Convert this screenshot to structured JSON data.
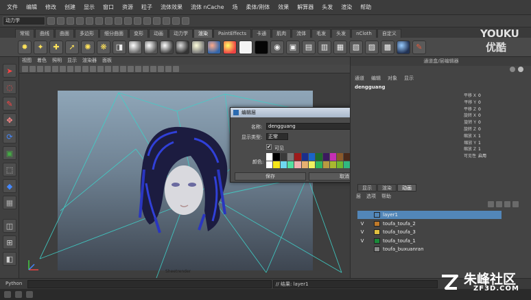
{
  "menubar": {
    "items": [
      "文件",
      "编辑",
      "修改",
      "创建",
      "显示",
      "窗口",
      "资源",
      "粒子",
      "流体效果",
      "流体 nCache",
      "场",
      "柔体/刚体",
      "效果",
      "解算器",
      "头发",
      "渲染",
      "帮助"
    ]
  },
  "statusline": {
    "mode": "动力学"
  },
  "shelf": {
    "tabs": [
      "常规",
      "曲线",
      "曲面",
      "多边形",
      "细分曲面",
      "变形",
      "动画",
      "动力学",
      "渲染",
      "PaintEffects",
      "卡通",
      "肌肉",
      "流体",
      "毛发",
      "头发",
      "nCloth",
      "自定义"
    ],
    "active_tab": "渲染"
  },
  "viewport": {
    "menu": [
      "视图",
      "着色",
      "照明",
      "显示",
      "渲染器",
      "面板"
    ],
    "camera_label": "Sheetrender"
  },
  "dialog": {
    "title": "编辑层",
    "name_label": "名称:",
    "name_value": "dengguang",
    "display_type_label": "显示类型:",
    "display_type_value": "正常",
    "visible_label": "可见",
    "visible_checked": "✔",
    "color_label": "颜色:",
    "save_label": "保存",
    "cancel_label": "取消",
    "minimize": "_",
    "maximize": "□",
    "close": "x",
    "colors_row1": [
      "#ffffff",
      "#000000",
      "#3a3a3a",
      "#7a7a7a",
      "#9e1b1b",
      "#1b2f8c",
      "#1a64c8",
      "#1f6b2b",
      "#3b1a5e",
      "#c62fb5",
      "#8b5a2b",
      "#4a2a1a",
      "#b83a1a",
      "#d41a1a",
      "#1fb81f",
      "#1a4ea8"
    ],
    "colors_row2": [
      "#ffffff",
      "#f5e61a",
      "#6fd8f0",
      "#53e0a0",
      "#f0b0b0",
      "#e8b070",
      "#f0f060",
      "#30b860",
      "#b89a40",
      "#a8b830",
      "#70b830",
      "#30b880",
      "#30b8b8",
      "#3070b8",
      "#8040b8",
      "#b83080"
    ]
  },
  "channel_box": {
    "header": "通道盒/层编辑器",
    "menu": [
      "通道",
      "编辑",
      "对象",
      "显示"
    ],
    "node": "dengguang",
    "attributes": [
      {
        "name": "平移 X",
        "value": "0"
      },
      {
        "name": "平移 Y",
        "value": "0"
      },
      {
        "name": "平移 Z",
        "value": "0"
      },
      {
        "name": "旋转 X",
        "value": "0"
      },
      {
        "name": "旋转 Y",
        "value": "0"
      },
      {
        "name": "旋转 Z",
        "value": "0"
      },
      {
        "name": "缩放 X",
        "value": "1"
      },
      {
        "name": "缩放 Y",
        "value": "1"
      },
      {
        "name": "缩放 Z",
        "value": "1"
      },
      {
        "name": "可见性",
        "value": "启用"
      }
    ]
  },
  "layer_editor": {
    "tabs": [
      "显示",
      "渲染",
      "动画"
    ],
    "active_tab": "动画",
    "menu": [
      "层",
      "选项",
      "帮助"
    ],
    "layers": [
      {
        "vis": "",
        "name": "layer1",
        "color": "#5286b8",
        "selected": true
      },
      {
        "vis": "V",
        "name": "toufa_toufa_2",
        "color": "#c07a2a",
        "selected": false
      },
      {
        "vis": "V",
        "name": "toufa_toufa_3",
        "color": "#e0c040",
        "selected": false
      },
      {
        "vis": "V",
        "name": "toufa_toufa_1",
        "color": "#1a8a3a",
        "selected": false
      },
      {
        "vis": "",
        "name": "toufa_buxuanran",
        "color": "#8a8a8a",
        "selected": false
      }
    ]
  },
  "commandline": {
    "label": "Python",
    "result": "// 结果: layer1"
  },
  "watermarks": {
    "youku": "YOUKU",
    "youku_cn": "优酷",
    "zf_text": "朱峰社区",
    "zf_url": "ZF3D.COM"
  }
}
